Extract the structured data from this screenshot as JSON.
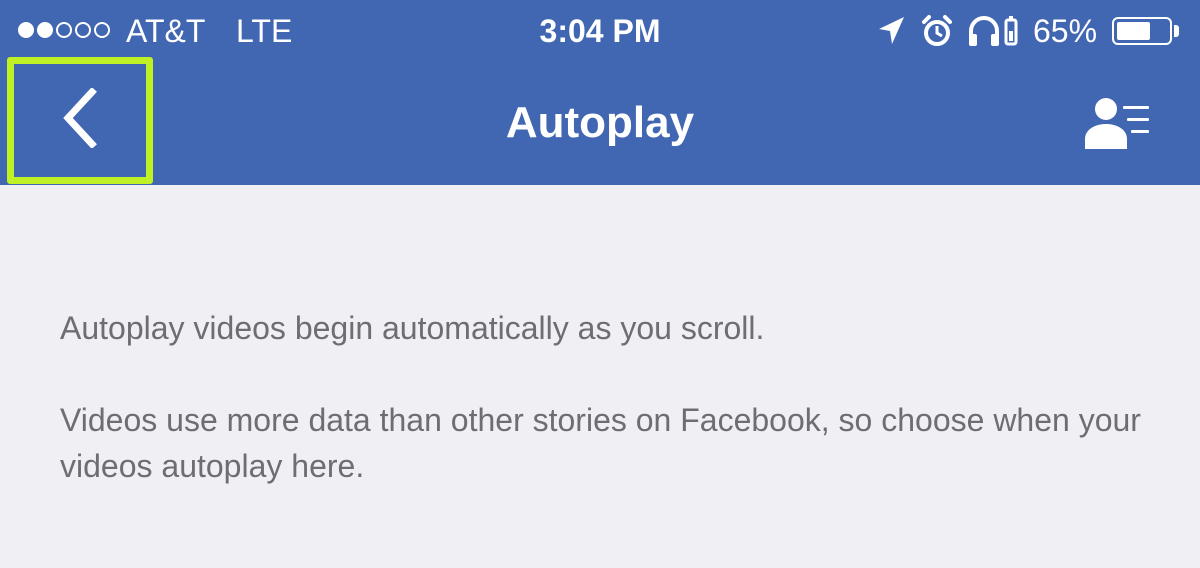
{
  "status_bar": {
    "signal_filled": 2,
    "signal_total": 5,
    "carrier": "AT&T",
    "network": "LTE",
    "time": "3:04 PM",
    "icons": [
      "location-arrow-icon",
      "alarm-clock-icon",
      "headphones-icon",
      "battery-icon"
    ],
    "battery_percent": "65%",
    "battery_level": 0.65
  },
  "nav": {
    "back_icon": "chevron-left-icon",
    "title": "Autoplay",
    "right_icon": "profile-menu-icon"
  },
  "content": {
    "paragraph_1": "Autoplay videos begin automatically as you scroll.",
    "paragraph_2": "Videos use more data than other stories on Facebook, so choose when your videos autoplay here."
  },
  "colors": {
    "header_bg": "#4267b2",
    "page_bg": "#efeff4",
    "body_text": "#6d6d72",
    "highlight": "#bff125"
  }
}
